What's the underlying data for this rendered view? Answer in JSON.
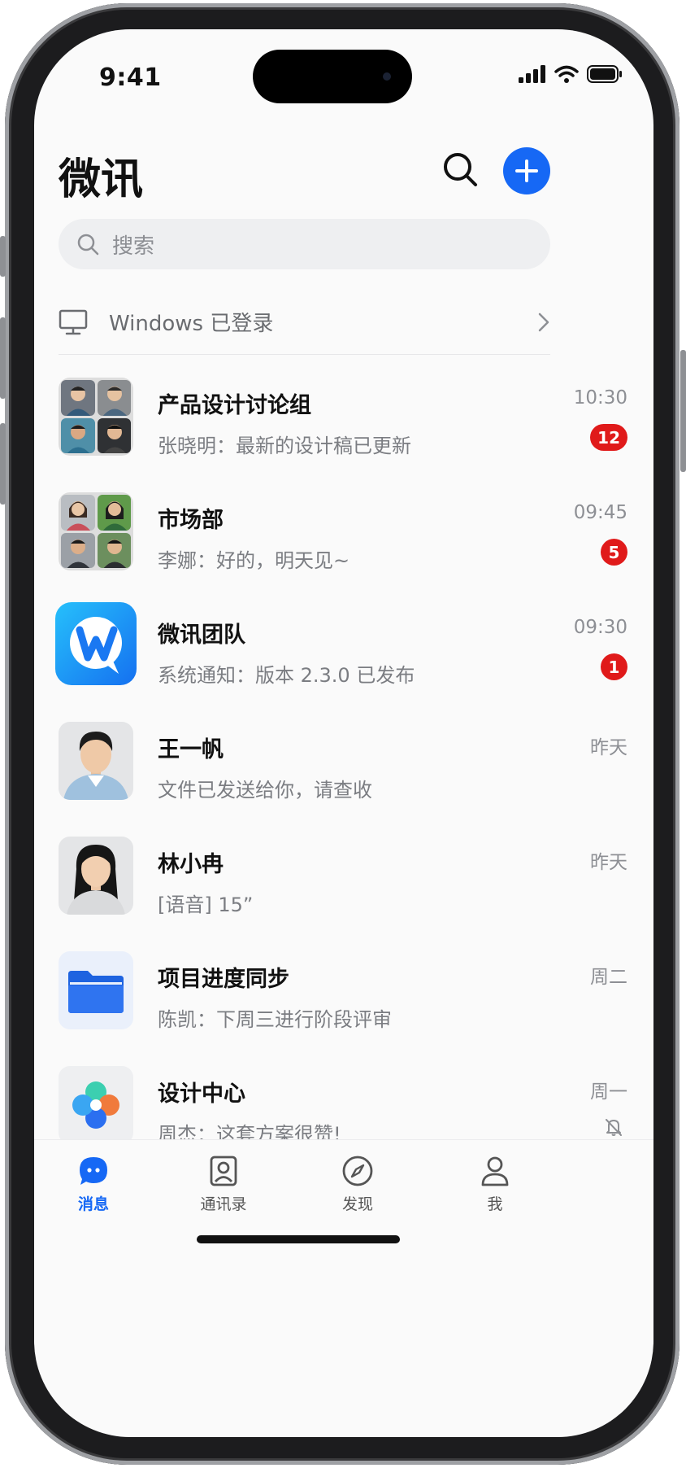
{
  "status_bar": {
    "time": "9:41"
  },
  "header": {
    "title": "微讯",
    "search_icon": "search-icon",
    "add_icon": "plus-icon",
    "accent_color": "#1668f5"
  },
  "search": {
    "placeholder": "搜索"
  },
  "login_banner": {
    "text": "Windows 已登录"
  },
  "chats": [
    {
      "name": "产品设计讨论组",
      "preview": "张晓明：最新的设计稿已更新",
      "time": "10:30",
      "unread": "12"
    },
    {
      "name": "市场部",
      "preview": "李娜：好的，明天见~",
      "time": "09:45",
      "unread": "5"
    },
    {
      "name": "微讯团队",
      "preview": "系统通知：版本 2.3.0 已发布",
      "time": "09:30",
      "unread": "1"
    },
    {
      "name": "王一帆",
      "preview": "文件已发送给你，请查收",
      "time": "昨天"
    },
    {
      "name": "林小冉",
      "preview": "[语音] 15”",
      "time": "昨天"
    },
    {
      "name": "项目进度同步",
      "preview": "陈凯：下周三进行阶段评审",
      "time": "周二"
    },
    {
      "name": "设计中心",
      "preview": "周杰：这套方案很赞!",
      "time": "周一",
      "muted": true
    }
  ],
  "tabs": [
    {
      "label": "消息",
      "icon": "chat-bubble-icon",
      "active": true
    },
    {
      "label": "通讯录",
      "icon": "contacts-icon"
    },
    {
      "label": "发现",
      "icon": "compass-icon"
    },
    {
      "label": "我",
      "icon": "person-icon"
    }
  ],
  "badge_color": "#e01a1a"
}
